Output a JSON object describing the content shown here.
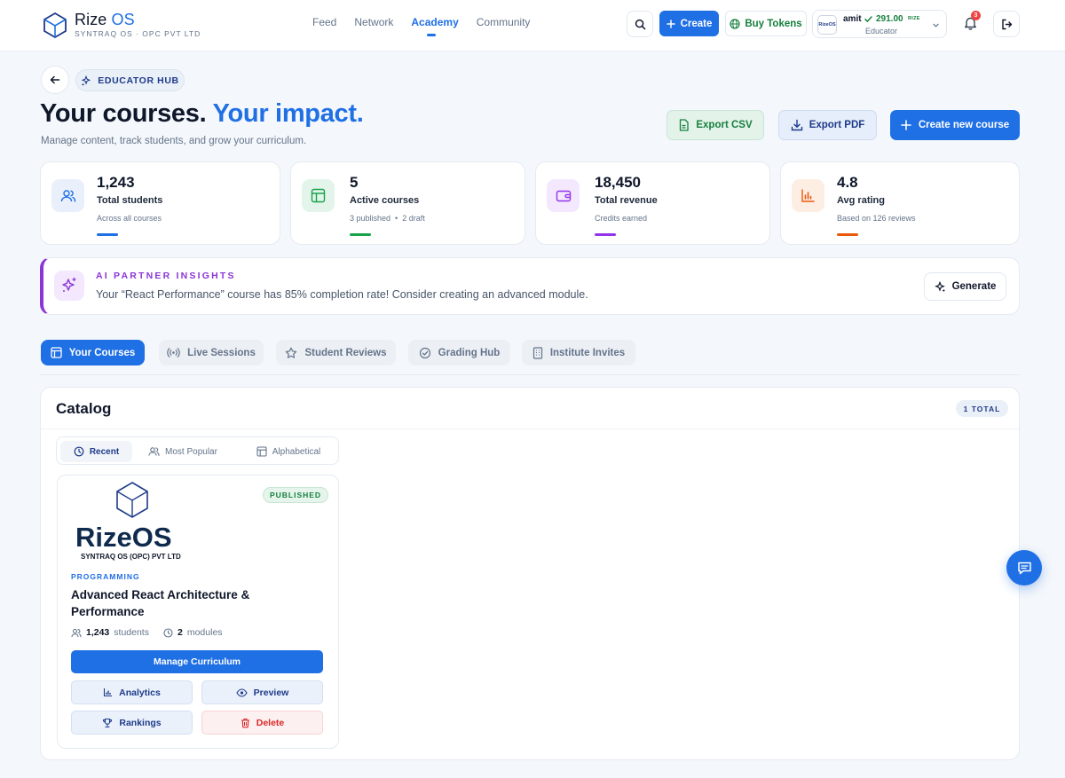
{
  "brand": {
    "name_a": "Rize",
    "name_b": "OS",
    "subtitle": "SYNTRAQ OS · OPC PVT LTD"
  },
  "nav": {
    "links": [
      "Feed",
      "Network",
      "Academy",
      "Community"
    ],
    "active": "Academy"
  },
  "topbar": {
    "create_label": "Create",
    "tokens_label": "Buy Tokens",
    "user": {
      "name": "amit",
      "balance": "291.00",
      "unit": "RIZE",
      "role": "Educator",
      "avatar_text": "RizeOS"
    },
    "notifications": "3"
  },
  "header": {
    "hub_label": "EDUCATOR HUB",
    "title_a": "Your courses.",
    "title_b": "Your impact.",
    "subtitle": "Manage content, track students, and grow your curriculum.",
    "export_csv": "Export CSV",
    "export_pdf": "Export PDF",
    "create_course": "Create new course"
  },
  "stats": [
    {
      "value": "1,243",
      "label": "Total students",
      "sub": "Across all courses",
      "color": "#1f6fe5"
    },
    {
      "value": "5",
      "label": "Active courses",
      "sub": "3 published  •  2 draft",
      "color": "#16a34a"
    },
    {
      "value": "18,450",
      "label": "Total revenue",
      "sub": "Credits earned",
      "color": "#9333ea"
    },
    {
      "value": "4.8",
      "label": "Avg rating",
      "sub": "Based on 126 reviews",
      "color": "#ea580c"
    }
  ],
  "ai": {
    "title": "AI PARTNER INSIGHTS",
    "text": "Your “React Performance” course has 85% completion rate! Consider creating an advanced module.",
    "generate": "Generate"
  },
  "tabs": [
    "Your Courses",
    "Live Sessions",
    "Student Reviews",
    "Grading Hub",
    "Institute Invites"
  ],
  "catalog": {
    "title": "Catalog",
    "total": "1 TOTAL",
    "sort": [
      "Recent",
      "Most Popular",
      "Alphabetical"
    ],
    "course": {
      "logo_word": "RizeOS",
      "logo_sub": "SYNTRAQ OS (OPC) PVT LTD",
      "status": "PUBLISHED",
      "category": "PROGRAMMING",
      "title": "Advanced React Architecture & Performance",
      "students_count": "1,243",
      "students_label": "students",
      "modules_count": "2",
      "modules_label": "modules",
      "manage": "Manage Curriculum",
      "analytics": "Analytics",
      "preview": "Preview",
      "rankings": "Rankings",
      "delete": "Delete"
    }
  },
  "icons": [
    "search-icon",
    "plus-icon",
    "globe-icon",
    "check-icon",
    "chevron-down-icon",
    "bell-icon",
    "logout-icon",
    "arrow-left-icon",
    "sparkle-icon",
    "file-icon",
    "download-icon",
    "users-icon",
    "layout-icon",
    "wallet-icon",
    "bar-chart-icon",
    "broadcast-icon",
    "star-icon",
    "check-circle-icon",
    "building-icon",
    "clock-icon",
    "eye-icon",
    "trophy-icon",
    "trash-icon",
    "chat-icon"
  ],
  "colors": {
    "accent": "#1f6fe5",
    "success": "#16a34a",
    "purple": "#8b35d6",
    "orange": "#ea580c",
    "danger": "#dc2626"
  }
}
